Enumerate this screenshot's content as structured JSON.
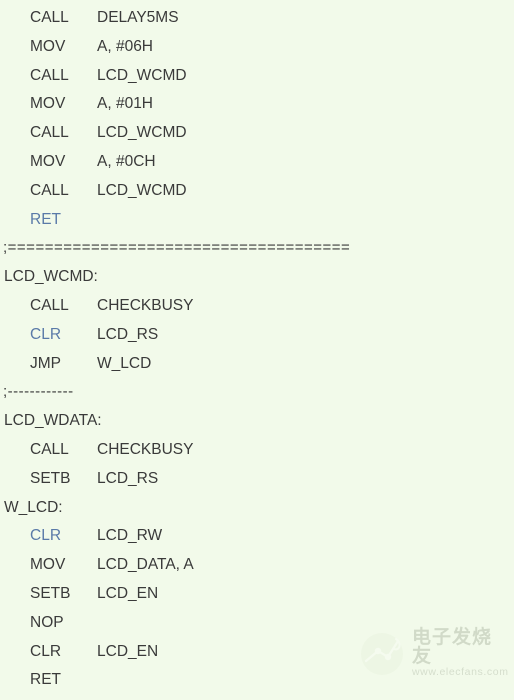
{
  "page": {
    "background_color": "#f2faea",
    "text_color": "#3a3a3a",
    "keyword_color": "#5a7aa8",
    "language": "8051 Assembly"
  },
  "code": {
    "lines": [
      {
        "kind": "instr",
        "mnemonic": "CALL",
        "operand": "DELAY5MS",
        "mnemonic_style": "dark",
        "operand_style": "dark"
      },
      {
        "kind": "instr",
        "mnemonic": "MOV",
        "operand": "A, #06H",
        "mnemonic_style": "dark",
        "operand_style": "dark"
      },
      {
        "kind": "instr",
        "mnemonic": "CALL",
        "operand": "LCD_WCMD",
        "mnemonic_style": "dark",
        "operand_style": "dark"
      },
      {
        "kind": "instr",
        "mnemonic": "MOV",
        "operand": "A, #01H",
        "mnemonic_style": "dark",
        "operand_style": "dark"
      },
      {
        "kind": "instr",
        "mnemonic": "CALL",
        "operand": "LCD_WCMD",
        "mnemonic_style": "dark",
        "operand_style": "dark"
      },
      {
        "kind": "instr",
        "mnemonic": "MOV",
        "operand": "A, #0CH",
        "mnemonic_style": "dark",
        "operand_style": "dark"
      },
      {
        "kind": "instr",
        "mnemonic": "CALL",
        "operand": "LCD_WCMD",
        "mnemonic_style": "dark",
        "operand_style": "dark"
      },
      {
        "kind": "instr",
        "mnemonic": "RET",
        "operand": "",
        "mnemonic_style": "blue",
        "operand_style": "dark"
      },
      {
        "kind": "comment",
        "text": ";====================================="
      },
      {
        "kind": "label",
        "text": "LCD_WCMD:"
      },
      {
        "kind": "instr",
        "mnemonic": "CALL",
        "operand": "CHECKBUSY",
        "mnemonic_style": "dark",
        "operand_style": "dark"
      },
      {
        "kind": "instr",
        "mnemonic": "CLR",
        "operand": "LCD_RS",
        "mnemonic_style": "blue",
        "operand_style": "dark"
      },
      {
        "kind": "instr",
        "mnemonic": "JMP",
        "operand": "W_LCD",
        "mnemonic_style": "dark",
        "operand_style": "dark"
      },
      {
        "kind": "comment",
        "text": ";------------"
      },
      {
        "kind": "label",
        "text": "LCD_WDATA:"
      },
      {
        "kind": "instr",
        "mnemonic": "CALL",
        "operand": "CHECKBUSY",
        "mnemonic_style": "dark",
        "operand_style": "dark"
      },
      {
        "kind": "instr",
        "mnemonic": "SETB",
        "operand": "LCD_RS",
        "mnemonic_style": "dark",
        "operand_style": "dark"
      },
      {
        "kind": "label",
        "text": "W_LCD:"
      },
      {
        "kind": "instr",
        "mnemonic": "CLR",
        "operand": "LCD_RW",
        "mnemonic_style": "blue",
        "operand_style": "dark"
      },
      {
        "kind": "instr",
        "mnemonic": "MOV",
        "operand": "LCD_DATA, A",
        "mnemonic_style": "dark",
        "operand_style": "dark"
      },
      {
        "kind": "instr",
        "mnemonic": "SETB",
        "operand": "LCD_EN",
        "mnemonic_style": "dark",
        "operand_style": "dark"
      },
      {
        "kind": "instr",
        "mnemonic": "NOP",
        "operand": "",
        "mnemonic_style": "dark",
        "operand_style": "dark"
      },
      {
        "kind": "instr",
        "mnemonic": "CLR",
        "operand": "LCD_EN",
        "mnemonic_style": "dark",
        "operand_style": "dark"
      },
      {
        "kind": "instr",
        "mnemonic": "RET",
        "operand": "",
        "mnemonic_style": "dark",
        "operand_style": "dark"
      }
    ]
  },
  "watermark": {
    "site_name": "电子发烧友",
    "url": "www.elecfans.com"
  }
}
